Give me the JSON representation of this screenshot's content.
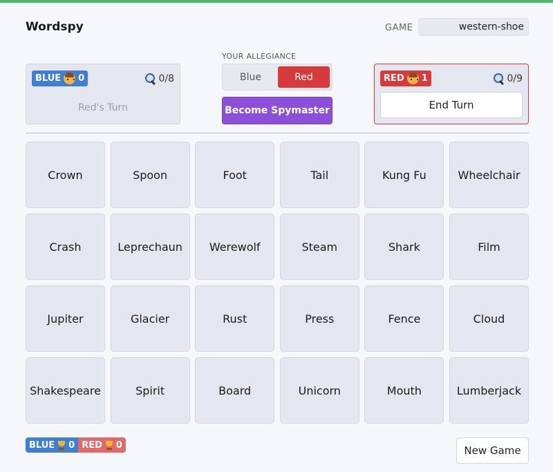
{
  "app": {
    "title": "Wordspy",
    "game_label": "GAME",
    "game_id": "western-shoe"
  },
  "colors": {
    "blue": "#3f7fd3",
    "red": "#d63a3a",
    "spymaster": "#8b4fd8",
    "topbar": "#4cb86b"
  },
  "blue_team": {
    "label": "BLUE",
    "players": "0",
    "guess": "0/8",
    "status": "Red's Turn"
  },
  "red_team": {
    "label": "RED",
    "players": "1",
    "guess": "0/9",
    "end_turn_label": "End Turn"
  },
  "allegiance": {
    "label": "YOUR ALLEGIANCE",
    "options": [
      "Blue",
      "Red"
    ],
    "selected": "Red",
    "spymaster_label": "Become Spymaster"
  },
  "board": {
    "cards": [
      "Crown",
      "Spoon",
      "Foot",
      "Tail",
      "Kung Fu",
      "Wheelchair",
      "Crash",
      "Leprechaun",
      "Werewolf",
      "Steam",
      "Shark",
      "Film",
      "Jupiter",
      "Glacier",
      "Rust",
      "Press",
      "Fence",
      "Cloud",
      "Shakespeare",
      "Spirit",
      "Board",
      "Unicorn",
      "Mouth",
      "Lumberjack"
    ]
  },
  "score": {
    "blue_label": "BLUE",
    "blue_wins": "0",
    "red_label": "RED",
    "red_wins": "0"
  },
  "footer": {
    "new_game_label": "New Game"
  }
}
